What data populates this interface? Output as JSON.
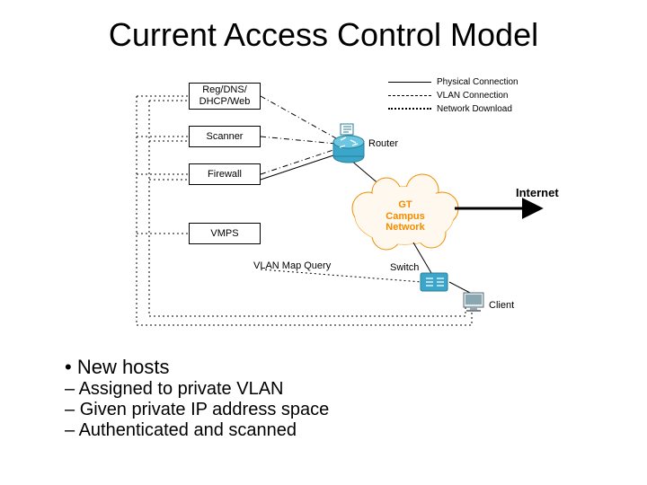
{
  "title": "Current Access Control Model",
  "legend": {
    "physical": "Physical Connection",
    "vlan": "VLAN Connection",
    "download": "Network Download"
  },
  "nodes": {
    "reg": "Reg/DNS/\nDHCP/Web",
    "scanner": "Scanner",
    "firewall": "Firewall",
    "vmps": "VMPS",
    "router": "Router",
    "campus": "GT\nCampus\nNetwork",
    "switch": "Switch",
    "client": "Client",
    "internet": "Internet",
    "vlanquery": "VLAN Map Query"
  },
  "bullet_main": "New hosts",
  "bullet_sub": [
    "Assigned to private VLAN",
    "Given private IP address space",
    "Authenticated and scanned"
  ]
}
